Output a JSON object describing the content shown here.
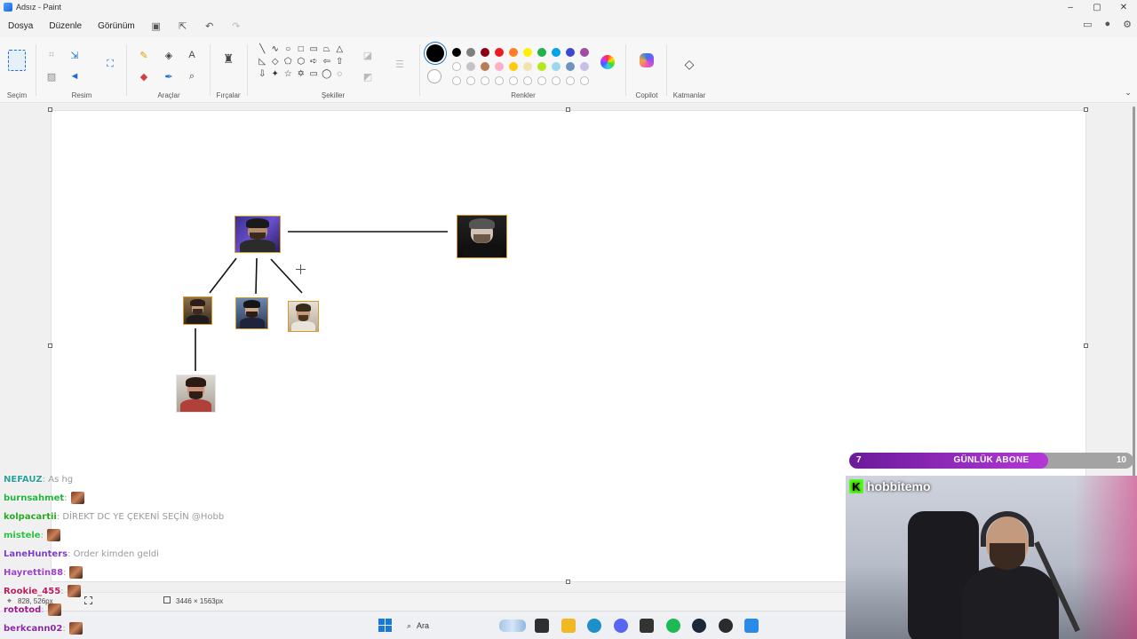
{
  "window": {
    "title": "Adsız - Paint",
    "controls": {
      "minimize": "–",
      "maximize": "▢",
      "close": "✕"
    }
  },
  "menu": {
    "items": [
      "Dosya",
      "Düzenle",
      "Görünüm"
    ],
    "quick_actions": [
      "save-icon",
      "share-icon",
      "undo-icon",
      "redo-icon"
    ]
  },
  "ribbon": {
    "groups": {
      "selection": "Seçim",
      "image": "Resim",
      "tools": "Araçlar",
      "brushes": "Fırçalar",
      "shapes": "Şekiller",
      "colors": "Renkler",
      "copilot": "Copilot",
      "layers": "Katmanlar"
    },
    "shapes_glyphs": [
      "╲",
      "∿",
      "○",
      "□",
      "▭",
      "⏢",
      "△",
      "◺",
      "◇",
      "⬠",
      "⬡",
      "➪",
      "⇦",
      "⇧",
      "⇩",
      "✦",
      "☆",
      "✡",
      "▭",
      "◯",
      "◌"
    ],
    "palette": {
      "current": "#000000",
      "secondary": "#ffffff",
      "row1": [
        "#000000",
        "#7f7f7f",
        "#880015",
        "#ed1c24",
        "#ff7f27",
        "#fff200",
        "#22b14c",
        "#00a2e8",
        "#3f48cc",
        "#a349a4"
      ],
      "row2": [
        "#ffffff",
        "#c3c3c3",
        "#b97a57",
        "#ffaec9",
        "#ffc90e",
        "#efe4b0",
        "#b5e61d",
        "#99d9ea",
        "#7092be",
        "#c8bfe7"
      ],
      "row3_empty_count": 10
    }
  },
  "status": {
    "cursor_position": "828, 526px",
    "canvas_size": "3446 × 1563px"
  },
  "chat": {
    "messages": [
      {
        "user": "NEFAUZ",
        "color": "#2aa198",
        "text": ": As hg",
        "emote": false
      },
      {
        "user": "burnsahmet",
        "color": "#1fb43a",
        "text": " :",
        "emote": true
      },
      {
        "user": "kolpacartii",
        "color": "#22aa22",
        "text": ": DİREKT DC YE ÇEKENİ SEÇİN @Hobb",
        "emote": false
      },
      {
        "user": "mistele",
        "color": "#28c23c",
        "text": " :",
        "emote": true
      },
      {
        "user": "LaneHunters",
        "color": "#7a3bd0",
        "text": ": Order kimden geldi",
        "emote": false
      },
      {
        "user": "Hayrettin88",
        "color": "#9b40c9",
        "text": " :",
        "emote": true
      },
      {
        "user": "Rookie_455",
        "color": "#c2185b",
        "text": " :",
        "emote": true
      },
      {
        "user": "rototod",
        "color": "#a0148f",
        "text": " :",
        "emote": true
      },
      {
        "user": "berkcann02",
        "color": "#8e24aa",
        "text": " :",
        "emote": true
      }
    ]
  },
  "overlay": {
    "sub_goal": {
      "current": "7",
      "label": "GÜNLÜK ABONE",
      "target": "10",
      "progress": 0.7
    },
    "streamer": "hobbitemo",
    "platform_icon": "kick-logo-icon"
  },
  "taskbar": {
    "search_placeholder": "Ara",
    "apps": [
      {
        "name": "file-explorer-icon",
        "color": "#2f2f2f"
      },
      {
        "name": "folder-icon",
        "color": "#f2b824"
      },
      {
        "name": "edge-icon",
        "color": "#1e90c9"
      },
      {
        "name": "discord-icon",
        "color": "#5865f2"
      },
      {
        "name": "terminal-icon",
        "color": "#333333"
      },
      {
        "name": "spotify-icon",
        "color": "#1db954"
      },
      {
        "name": "steam-icon",
        "color": "#1b2838"
      },
      {
        "name": "obs-icon",
        "color": "#2b2b2b"
      },
      {
        "name": "paint-icon",
        "color": "#2a8be6"
      }
    ]
  }
}
